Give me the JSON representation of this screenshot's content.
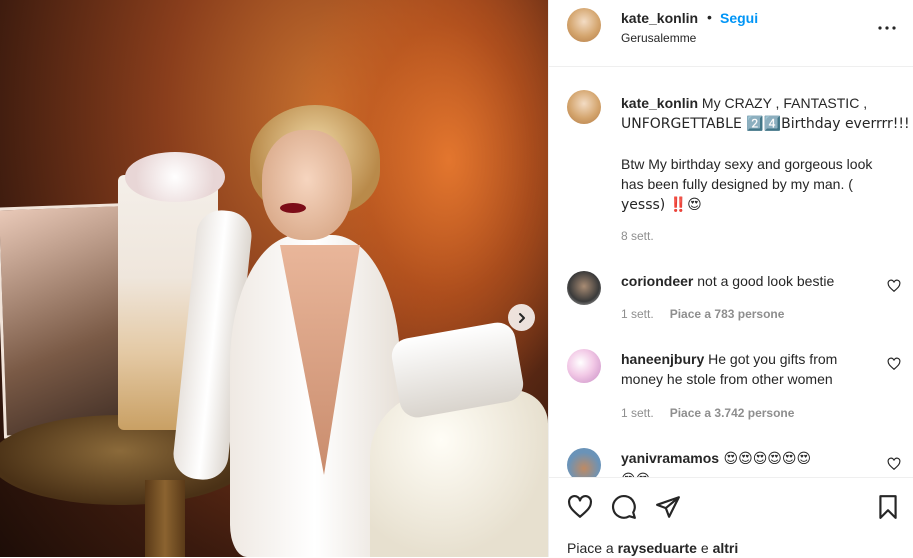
{
  "header": {
    "username": "kate_konlin",
    "dot": "•",
    "follow_label": "Segui",
    "location": "Gerusalemme",
    "more_icon": "more-horizontal-icon"
  },
  "caption": {
    "username": "kate_konlin",
    "line1": " My CRAZY , FANTASTIC ,",
    "line2": "UNFORGETTABLE 2️⃣4️⃣Birthday everrrr!!!",
    "line3": "Btw My birthday sexy and gorgeous look",
    "line4": "has been fully designed by my man. (",
    "line5": "yesss) ‼️😍",
    "time": "8 sett."
  },
  "comments": [
    {
      "username": "coriondeer",
      "line1": " not a good look bestie",
      "line2": "",
      "time": "1 sett.",
      "likes": "Piace a 783 persone"
    },
    {
      "username": "haneenjbury",
      "line1": " He got you gifts from",
      "line2": "money he stole from other women",
      "time": "1 sett.",
      "likes": "Piace a 3.742 persone"
    },
    {
      "username": "yanivramamos",
      "line1": " 😍😍😍😍😍😍",
      "line2": "😍😍",
      "time": "",
      "likes": ""
    }
  ],
  "likes_bar": {
    "prefix": "Piace a ",
    "user": "rayseduarte",
    "suffix": " e ",
    "others": "altri"
  },
  "icons": {
    "like": "heart-icon",
    "comment": "comment-icon",
    "share": "send-icon",
    "save": "bookmark-icon",
    "next": "chevron-right-icon"
  },
  "colors": {
    "link": "#0095f6",
    "muted": "#8e8e8e",
    "text": "#262626"
  }
}
